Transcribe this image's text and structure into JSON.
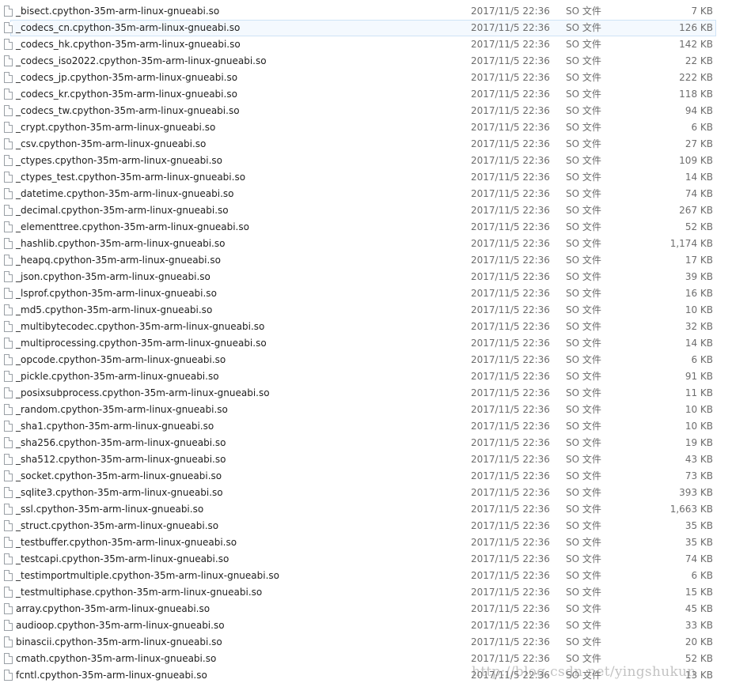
{
  "file_list": {
    "selected_index": 1,
    "rows": [
      {
        "name": "_bisect.cpython-35m-arm-linux-gnueabi.so",
        "date": "2017/11/5 22:36",
        "type": "SO 文件",
        "size": "7 KB"
      },
      {
        "name": "_codecs_cn.cpython-35m-arm-linux-gnueabi.so",
        "date": "2017/11/5 22:36",
        "type": "SO 文件",
        "size": "126 KB"
      },
      {
        "name": "_codecs_hk.cpython-35m-arm-linux-gnueabi.so",
        "date": "2017/11/5 22:36",
        "type": "SO 文件",
        "size": "142 KB"
      },
      {
        "name": "_codecs_iso2022.cpython-35m-arm-linux-gnueabi.so",
        "date": "2017/11/5 22:36",
        "type": "SO 文件",
        "size": "22 KB"
      },
      {
        "name": "_codecs_jp.cpython-35m-arm-linux-gnueabi.so",
        "date": "2017/11/5 22:36",
        "type": "SO 文件",
        "size": "222 KB"
      },
      {
        "name": "_codecs_kr.cpython-35m-arm-linux-gnueabi.so",
        "date": "2017/11/5 22:36",
        "type": "SO 文件",
        "size": "118 KB"
      },
      {
        "name": "_codecs_tw.cpython-35m-arm-linux-gnueabi.so",
        "date": "2017/11/5 22:36",
        "type": "SO 文件",
        "size": "94 KB"
      },
      {
        "name": "_crypt.cpython-35m-arm-linux-gnueabi.so",
        "date": "2017/11/5 22:36",
        "type": "SO 文件",
        "size": "6 KB"
      },
      {
        "name": "_csv.cpython-35m-arm-linux-gnueabi.so",
        "date": "2017/11/5 22:36",
        "type": "SO 文件",
        "size": "27 KB"
      },
      {
        "name": "_ctypes.cpython-35m-arm-linux-gnueabi.so",
        "date": "2017/11/5 22:36",
        "type": "SO 文件",
        "size": "109 KB"
      },
      {
        "name": "_ctypes_test.cpython-35m-arm-linux-gnueabi.so",
        "date": "2017/11/5 22:36",
        "type": "SO 文件",
        "size": "14 KB"
      },
      {
        "name": "_datetime.cpython-35m-arm-linux-gnueabi.so",
        "date": "2017/11/5 22:36",
        "type": "SO 文件",
        "size": "74 KB"
      },
      {
        "name": "_decimal.cpython-35m-arm-linux-gnueabi.so",
        "date": "2017/11/5 22:36",
        "type": "SO 文件",
        "size": "267 KB"
      },
      {
        "name": "_elementtree.cpython-35m-arm-linux-gnueabi.so",
        "date": "2017/11/5 22:36",
        "type": "SO 文件",
        "size": "52 KB"
      },
      {
        "name": "_hashlib.cpython-35m-arm-linux-gnueabi.so",
        "date": "2017/11/5 22:36",
        "type": "SO 文件",
        "size": "1,174 KB"
      },
      {
        "name": "_heapq.cpython-35m-arm-linux-gnueabi.so",
        "date": "2017/11/5 22:36",
        "type": "SO 文件",
        "size": "17 KB"
      },
      {
        "name": "_json.cpython-35m-arm-linux-gnueabi.so",
        "date": "2017/11/5 22:36",
        "type": "SO 文件",
        "size": "39 KB"
      },
      {
        "name": "_lsprof.cpython-35m-arm-linux-gnueabi.so",
        "date": "2017/11/5 22:36",
        "type": "SO 文件",
        "size": "16 KB"
      },
      {
        "name": "_md5.cpython-35m-arm-linux-gnueabi.so",
        "date": "2017/11/5 22:36",
        "type": "SO 文件",
        "size": "10 KB"
      },
      {
        "name": "_multibytecodec.cpython-35m-arm-linux-gnueabi.so",
        "date": "2017/11/5 22:36",
        "type": "SO 文件",
        "size": "32 KB"
      },
      {
        "name": "_multiprocessing.cpython-35m-arm-linux-gnueabi.so",
        "date": "2017/11/5 22:36",
        "type": "SO 文件",
        "size": "14 KB"
      },
      {
        "name": "_opcode.cpython-35m-arm-linux-gnueabi.so",
        "date": "2017/11/5 22:36",
        "type": "SO 文件",
        "size": "6 KB"
      },
      {
        "name": "_pickle.cpython-35m-arm-linux-gnueabi.so",
        "date": "2017/11/5 22:36",
        "type": "SO 文件",
        "size": "91 KB"
      },
      {
        "name": "_posixsubprocess.cpython-35m-arm-linux-gnueabi.so",
        "date": "2017/11/5 22:36",
        "type": "SO 文件",
        "size": "11 KB"
      },
      {
        "name": "_random.cpython-35m-arm-linux-gnueabi.so",
        "date": "2017/11/5 22:36",
        "type": "SO 文件",
        "size": "10 KB"
      },
      {
        "name": "_sha1.cpython-35m-arm-linux-gnueabi.so",
        "date": "2017/11/5 22:36",
        "type": "SO 文件",
        "size": "10 KB"
      },
      {
        "name": "_sha256.cpython-35m-arm-linux-gnueabi.so",
        "date": "2017/11/5 22:36",
        "type": "SO 文件",
        "size": "19 KB"
      },
      {
        "name": "_sha512.cpython-35m-arm-linux-gnueabi.so",
        "date": "2017/11/5 22:36",
        "type": "SO 文件",
        "size": "43 KB"
      },
      {
        "name": "_socket.cpython-35m-arm-linux-gnueabi.so",
        "date": "2017/11/5 22:36",
        "type": "SO 文件",
        "size": "73 KB"
      },
      {
        "name": "_sqlite3.cpython-35m-arm-linux-gnueabi.so",
        "date": "2017/11/5 22:36",
        "type": "SO 文件",
        "size": "393 KB"
      },
      {
        "name": "_ssl.cpython-35m-arm-linux-gnueabi.so",
        "date": "2017/11/5 22:36",
        "type": "SO 文件",
        "size": "1,663 KB"
      },
      {
        "name": "_struct.cpython-35m-arm-linux-gnueabi.so",
        "date": "2017/11/5 22:36",
        "type": "SO 文件",
        "size": "35 KB"
      },
      {
        "name": "_testbuffer.cpython-35m-arm-linux-gnueabi.so",
        "date": "2017/11/5 22:36",
        "type": "SO 文件",
        "size": "35 KB"
      },
      {
        "name": "_testcapi.cpython-35m-arm-linux-gnueabi.so",
        "date": "2017/11/5 22:36",
        "type": "SO 文件",
        "size": "74 KB"
      },
      {
        "name": "_testimportmultiple.cpython-35m-arm-linux-gnueabi.so",
        "date": "2017/11/5 22:36",
        "type": "SO 文件",
        "size": "6 KB"
      },
      {
        "name": "_testmultiphase.cpython-35m-arm-linux-gnueabi.so",
        "date": "2017/11/5 22:36",
        "type": "SO 文件",
        "size": "15 KB"
      },
      {
        "name": "array.cpython-35m-arm-linux-gnueabi.so",
        "date": "2017/11/5 22:36",
        "type": "SO 文件",
        "size": "45 KB"
      },
      {
        "name": "audioop.cpython-35m-arm-linux-gnueabi.so",
        "date": "2017/11/5 22:36",
        "type": "SO 文件",
        "size": "33 KB"
      },
      {
        "name": "binascii.cpython-35m-arm-linux-gnueabi.so",
        "date": "2017/11/5 22:36",
        "type": "SO 文件",
        "size": "20 KB"
      },
      {
        "name": "cmath.cpython-35m-arm-linux-gnueabi.so",
        "date": "2017/11/5 22:36",
        "type": "SO 文件",
        "size": "52 KB"
      },
      {
        "name": "fcntl.cpython-35m-arm-linux-gnueabi.so",
        "date": "2017/11/5 22:36",
        "type": "SO 文件",
        "size": "13 KB"
      }
    ]
  },
  "watermark": {
    "text": "http://blog.csdn.net/yingshukun"
  }
}
